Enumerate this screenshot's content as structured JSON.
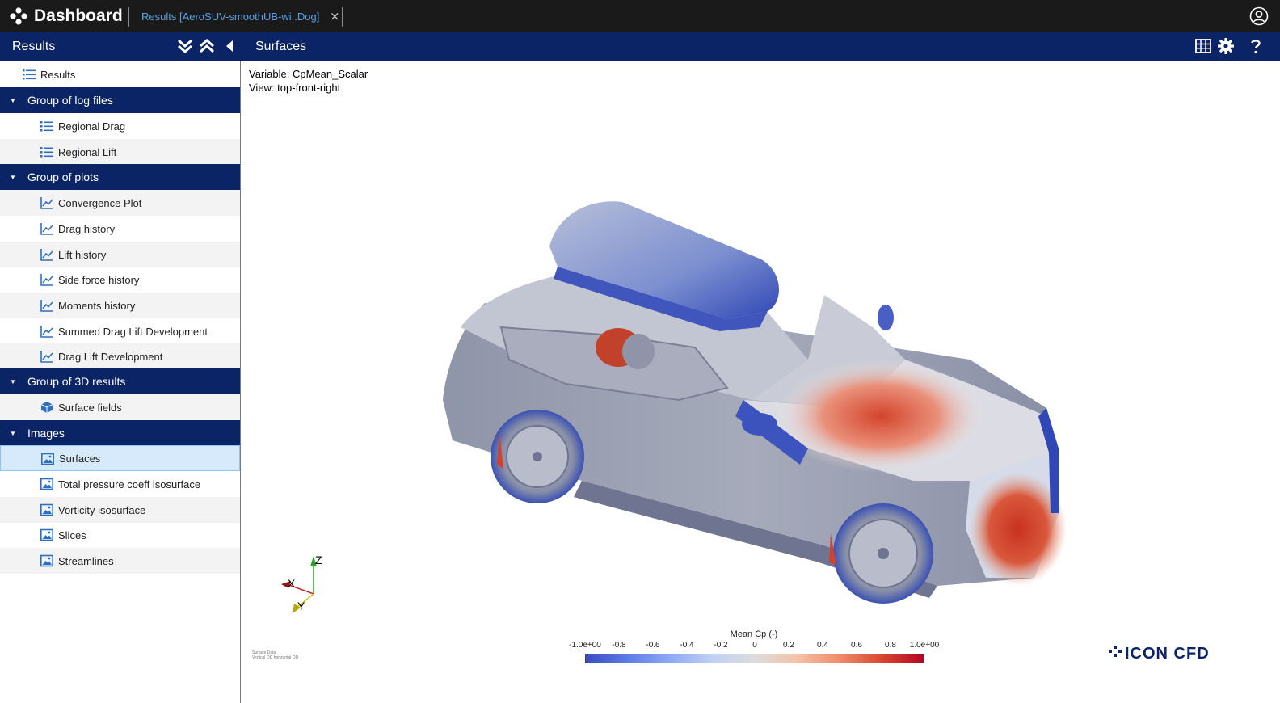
{
  "topbar": {
    "app_title": "Dashboard",
    "tab_label": "Results [AeroSUV-smoothUB-wi..Dog]",
    "tab_close": "×"
  },
  "subbar": {
    "left_title": "Results",
    "main_title": "Surfaces"
  },
  "sidebar": {
    "root": {
      "label": "Results",
      "icon": "list-icon"
    },
    "groups": [
      {
        "label": "Group of log files",
        "items": [
          {
            "label": "Regional Drag",
            "icon": "list-icon"
          },
          {
            "label": "Regional Lift",
            "icon": "list-icon"
          }
        ]
      },
      {
        "label": "Group of plots",
        "items": [
          {
            "label": "Convergence Plot",
            "icon": "line-chart-icon"
          },
          {
            "label": "Drag history",
            "icon": "line-chart-icon"
          },
          {
            "label": "Lift history",
            "icon": "line-chart-icon"
          },
          {
            "label": "Side force history",
            "icon": "line-chart-icon"
          },
          {
            "label": "Moments history",
            "icon": "line-chart-icon"
          },
          {
            "label": "Summed Drag Lift Development",
            "icon": "line-chart-icon"
          },
          {
            "label": "Drag Lift Development",
            "icon": "line-chart-icon"
          }
        ]
      },
      {
        "label": "Group of 3D results",
        "items": [
          {
            "label": "Surface fields",
            "icon": "cube-icon"
          }
        ]
      },
      {
        "label": "Images",
        "items": [
          {
            "label": "Surfaces",
            "icon": "image-icon",
            "selected": true
          },
          {
            "label": "Total pressure coeff isosurface",
            "icon": "image-icon"
          },
          {
            "label": "Vorticity isosurface",
            "icon": "image-icon"
          },
          {
            "label": "Slices",
            "icon": "image-icon"
          },
          {
            "label": "Streamlines",
            "icon": "image-icon"
          }
        ]
      }
    ]
  },
  "viewer": {
    "variable": "Variable: CpMean_Scalar",
    "view": "View: top-front-right",
    "small_note_line1": "Surface Data",
    "small_note_line2": "Vertical OD horizontal OD",
    "axes": {
      "x": "X",
      "y": "Y",
      "z": "Z"
    },
    "legend": {
      "title": "Mean Cp (-)",
      "ticks": [
        "-1.0e+00",
        "-0.8",
        "-0.6",
        "-0.4",
        "-0.2",
        "0",
        "0.2",
        "0.4",
        "0.6",
        "0.8",
        "1.0e+00"
      ],
      "colors": {
        "min": "#3a4cc0",
        "mid": "#dddcdc",
        "max": "#b40426"
      }
    },
    "logo_text": "ICON CFD"
  },
  "colors": {
    "topbar": "#1a1a1a",
    "navy": "#0b2466",
    "tab_link": "#5aa0e8",
    "selected_row": "#d6eafc"
  }
}
